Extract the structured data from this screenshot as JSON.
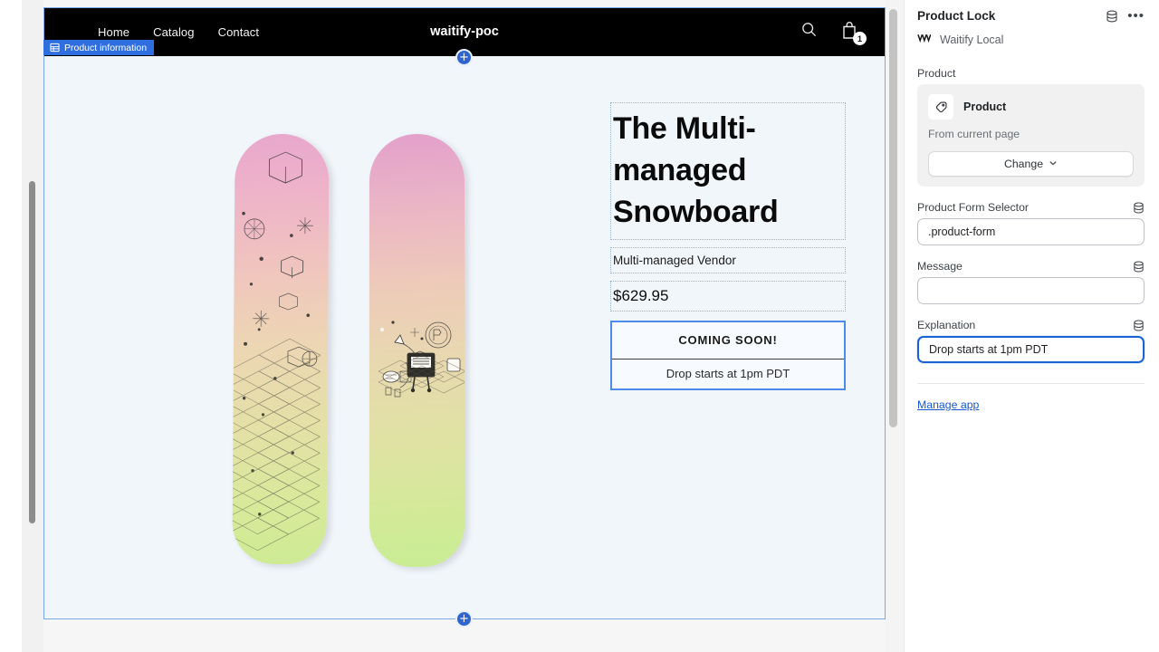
{
  "preview": {
    "storefront": {
      "nav": [
        {
          "label": "Home"
        },
        {
          "label": "Catalog"
        },
        {
          "label": "Contact"
        }
      ],
      "shop_name": "waitify-poc",
      "search_icon": "search-icon",
      "cart_icon": "shopping-bag-icon",
      "cart_count": "1"
    },
    "section_badge": {
      "label": "Product information",
      "icon": "section-layout-icon",
      "color": "#2f6ede"
    },
    "add_section_label": "+",
    "product": {
      "title": "The Multi-managed Snowboard",
      "vendor": "Multi-managed Vendor",
      "price": "$629.95",
      "cta_label": "COMING SOON!",
      "cta_sub_label": "Drop starts at 1pm PDT",
      "media_alt": "snowboard-pair-image"
    },
    "highlight_color": "#4e8ae8"
  },
  "sidebar": {
    "title": "Product Lock",
    "header_icons": {
      "data_source": "database-icon",
      "more": "more-horizontal-icon"
    },
    "app": {
      "icon": "waitify-logo-icon",
      "name": "Waitify Local"
    },
    "product_field": {
      "label": "Product",
      "card_icon": "product-tag-icon",
      "card_title": "Product",
      "card_subtitle": "From current page",
      "change_button": "Change",
      "change_chevron": "chevron-down-icon"
    },
    "fields": [
      {
        "label": "Product Form Selector",
        "value": ".product-form",
        "placeholder": "",
        "source_icon": "database-icon",
        "focused": false
      },
      {
        "label": "Message",
        "value": "",
        "placeholder": "",
        "source_icon": "database-icon",
        "focused": false
      },
      {
        "label": "Explanation",
        "value": "Drop starts at 1pm PDT",
        "placeholder": "",
        "source_icon": "database-icon",
        "focused": true
      }
    ],
    "manage_link": "Manage app",
    "link_color": "#1558d6"
  }
}
